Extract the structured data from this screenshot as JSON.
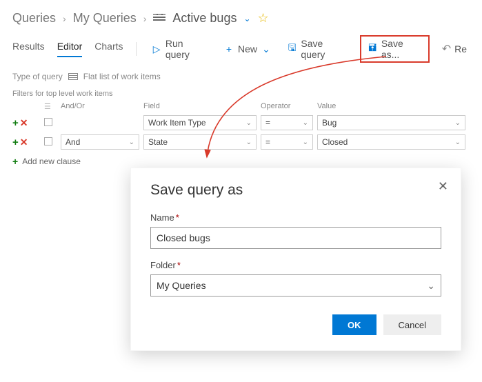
{
  "breadcrumb": {
    "root": "Queries",
    "folder": "My Queries",
    "title": "Active bugs"
  },
  "tabs": {
    "results": "Results",
    "editor": "Editor",
    "charts": "Charts"
  },
  "actions": {
    "run": "Run query",
    "new": "New",
    "save": "Save query",
    "saveas": "Save as...",
    "revert": "Re"
  },
  "typeOfQuery": {
    "label": "Type of query",
    "value": "Flat list of work items"
  },
  "filters": {
    "heading": "Filters for top level work items",
    "cols": {
      "andor": "And/Or",
      "field": "Field",
      "op": "Operator",
      "val": "Value"
    },
    "rows": [
      {
        "andor": "",
        "field": "Work Item Type",
        "op": "=",
        "val": "Bug"
      },
      {
        "andor": "And",
        "field": "State",
        "op": "=",
        "val": "Closed"
      }
    ],
    "add": "Add new clause"
  },
  "dialog": {
    "title": "Save query as",
    "nameLabel": "Name",
    "nameValue": "Closed bugs",
    "folderLabel": "Folder",
    "folderValue": "My Queries",
    "ok": "OK",
    "cancel": "Cancel"
  }
}
